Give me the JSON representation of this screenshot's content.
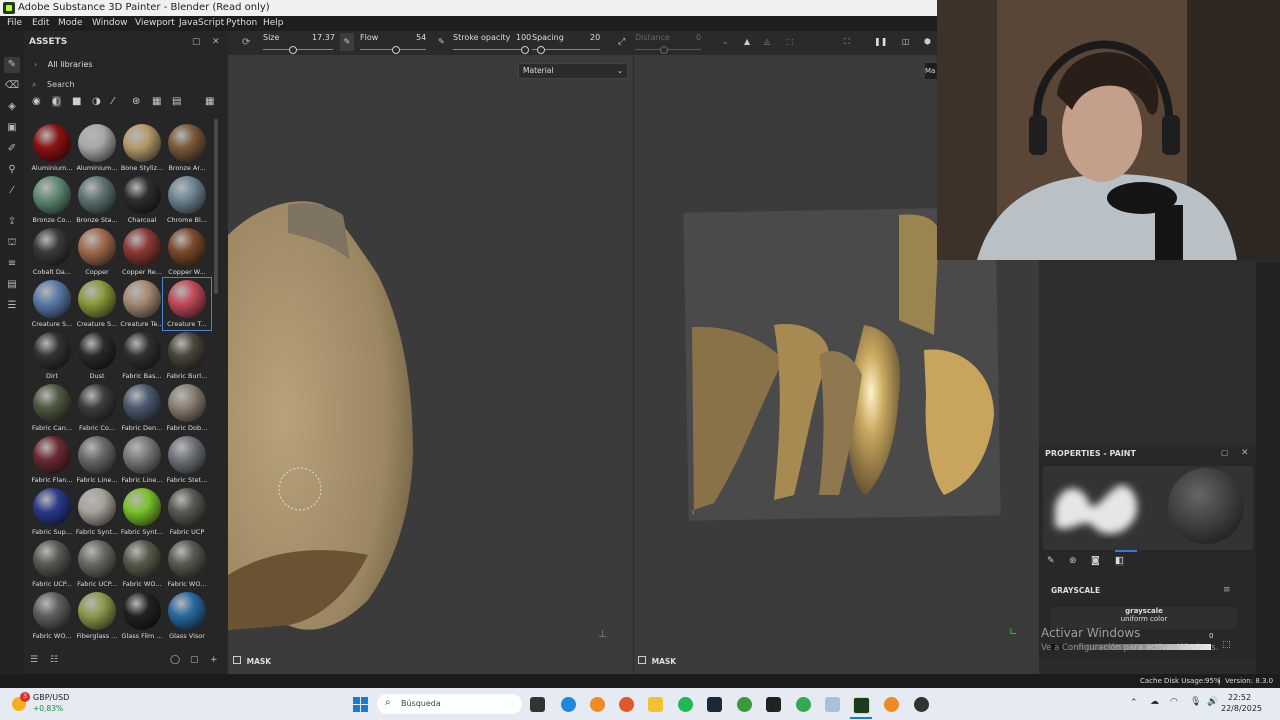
{
  "window": {
    "title": "Adobe Substance 3D Painter - Blender (Read only)"
  },
  "menu": [
    "File",
    "Edit",
    "Mode",
    "Window",
    "Viewport",
    "JavaScript",
    "Python",
    "Help"
  ],
  "toolbar": {
    "size_label": "Size",
    "size_value": "17.37",
    "flow_label": "Flow",
    "flow_value": "54",
    "stroke_opacity_label": "Stroke opacity",
    "stroke_opacity_value": "100",
    "spacing_label": "Spacing",
    "spacing_value": "20",
    "distance_label": "Distance",
    "distance_value": "0",
    "right_tab": "Ma"
  },
  "assets": {
    "title": "ASSETS",
    "libraries": "All libraries",
    "search_placeholder": "Search",
    "materials": [
      {
        "label": "Aluminium...",
        "color": "#8b1212"
      },
      {
        "label": "Aluminium...",
        "color": "#a8a8a8"
      },
      {
        "label": "Bone Styliz...",
        "color": "#b59a6a"
      },
      {
        "label": "Bronze Ar...",
        "color": "#7a5a3a"
      },
      {
        "label": "Bronze Co...",
        "color": "#5f8a72"
      },
      {
        "label": "Bronze Sta...",
        "color": "#5d7473"
      },
      {
        "label": "Charcoal",
        "color": "#2d2d2d"
      },
      {
        "label": "Chrome Bl...",
        "color": "#6f8592"
      },
      {
        "label": "Cobalt Da...",
        "color": "#3a3a3a"
      },
      {
        "label": "Copper",
        "color": "#a06a4c"
      },
      {
        "label": "Copper Re...",
        "color": "#8b3a36"
      },
      {
        "label": "Copper W...",
        "color": "#7a4a2a"
      },
      {
        "label": "Creature S...",
        "color": "#5a7aa8"
      },
      {
        "label": "Creature S...",
        "color": "#8a9a3a"
      },
      {
        "label": "Creature Te...",
        "color": "#a58a72"
      },
      {
        "label": "Creature T...",
        "color": "#c24a5a"
      },
      {
        "label": "Dirt",
        "color": "#333333"
      },
      {
        "label": "Dust",
        "color": "#2a2a2a"
      },
      {
        "label": "Fabric Bas...",
        "color": "#303030"
      },
      {
        "label": "Fabric Burl...",
        "color": "#4a463a"
      },
      {
        "label": "Fabric Can...",
        "color": "#4f5a3f"
      },
      {
        "label": "Fabric Co...",
        "color": "#3d3d3d"
      },
      {
        "label": "Fabric Den...",
        "color": "#4a5a6f"
      },
      {
        "label": "Fabric Dob...",
        "color": "#8a7f72"
      },
      {
        "label": "Fabric Flan...",
        "color": "#6a2a32"
      },
      {
        "label": "Fabric Line...",
        "color": "#6a6a6a"
      },
      {
        "label": "Fabric Line...",
        "color": "#7a7a7a"
      },
      {
        "label": "Fabric Stet...",
        "color": "#6f747a"
      },
      {
        "label": "Fabric Sup...",
        "color": "#2a3a8a"
      },
      {
        "label": "Fabric Synt...",
        "color": "#a8a29a"
      },
      {
        "label": "Fabric Synt...",
        "color": "#7ac22a"
      },
      {
        "label": "Fabric UCP",
        "color": "#5a5a52"
      },
      {
        "label": "Fabric UCP...",
        "color": "#5a5a52"
      },
      {
        "label": "Fabric UCP...",
        "color": "#6a6a62"
      },
      {
        "label": "Fabric WO...",
        "color": "#5a5a4a"
      },
      {
        "label": "Fabric WO...",
        "color": "#5a5a52"
      },
      {
        "label": "Fabric WO...",
        "color": "#5f5f5f"
      },
      {
        "label": "Fiberglass ...",
        "color": "#8a9a4a"
      },
      {
        "label": "Glass Film ...",
        "color": "#222222"
      },
      {
        "label": "Glass Visor",
        "color": "#2a6aa0"
      }
    ]
  },
  "viewport": {
    "material_dropdown": "Material",
    "mask_left": "MASK",
    "mask_right": "MASK"
  },
  "properties": {
    "title": "PROPERTIES - PAINT",
    "section": "GRAYSCALE",
    "value_name": "grayscale",
    "value_type": "uniform color",
    "value_number": "0"
  },
  "watermark": {
    "line1": "Activar Windows",
    "line2": "Ve a Configuración para activar Windows."
  },
  "status": {
    "cache": "Cache Disk Usage:",
    "cache_value": "95%",
    "version": "Version: 8.3.0"
  },
  "taskbar": {
    "ticker": "GBP/USD",
    "change": "+0,83%",
    "badge": "3",
    "search": "Búsqueda",
    "time": "22:52",
    "date": "22/8/2025"
  }
}
